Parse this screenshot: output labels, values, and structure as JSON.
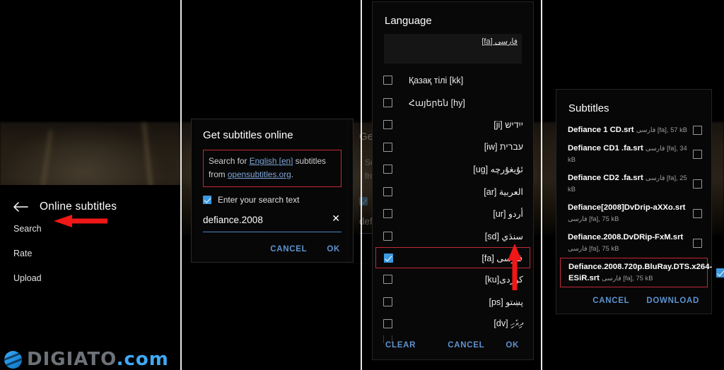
{
  "panel1": {
    "back_icon": "arrow-left-icon",
    "title": "Online subtitles",
    "items": [
      {
        "label": "Search"
      },
      {
        "label": "Rate"
      },
      {
        "label": "Upload"
      }
    ]
  },
  "watermark": {
    "name": "DIGIATO",
    "tld": ".com",
    "logo_icon": "digiato-logo-icon"
  },
  "panel2": {
    "title": "Get subtitles online",
    "desc_pre": "Search for ",
    "desc_link1": "English [en]",
    "desc_mid": " subtitles from ",
    "desc_link2": "opensubtitles.org",
    "desc_post": ".",
    "checkbox_label": "Enter your search text",
    "checkbox_checked": true,
    "search_value": "defiance.2008",
    "clear_icon": "close-icon",
    "cancel_label": "CANCEL",
    "ok_label": "OK"
  },
  "panel3": {
    "title": "Language",
    "filter_value": "فارسی [fa]",
    "languages": [
      {
        "label": "Қазақ тілі [kk]",
        "checked": false,
        "dir": "ltr"
      },
      {
        "label": "Հայերեն [hy]",
        "checked": false,
        "dir": "ltr"
      },
      {
        "label": "ייִדיש [ji]",
        "checked": false,
        "dir": "rtl"
      },
      {
        "label": "עברית [iw]",
        "checked": false,
        "dir": "rtl"
      },
      {
        "label": "ئۇيغۇرچە [ug]",
        "checked": false,
        "dir": "rtl"
      },
      {
        "label": "العربية [ar]",
        "checked": false,
        "dir": "rtl"
      },
      {
        "label": "أردو [ur]",
        "checked": false,
        "dir": "rtl"
      },
      {
        "label": "سنڌي [sd]",
        "checked": false,
        "dir": "rtl"
      },
      {
        "label": "فارسی [fa]",
        "checked": true,
        "dir": "rtl"
      },
      {
        "label": "کوردی[ku]",
        "checked": false,
        "dir": "rtl"
      },
      {
        "label": "پښتو [ps]",
        "checked": false,
        "dir": "rtl"
      },
      {
        "label": "ދިވެހި [dv]",
        "checked": false,
        "dir": "rtl"
      }
    ],
    "clear_label": "CLEAR",
    "cancel_label": "CANCEL",
    "ok_label": "OK"
  },
  "panel4": {
    "title": "Subtitles",
    "items": [
      {
        "name": "Defiance 1 CD.srt",
        "meta": "فارسی [fa], 57 kB",
        "checked": false
      },
      {
        "name": "Defiance  CD1 .fa.srt",
        "meta": "فارسی [fa], 34 kB",
        "checked": false
      },
      {
        "name": "Defiance  CD2 .fa.srt",
        "meta": "فارسی [fa], 25 kB",
        "checked": false
      },
      {
        "name": "Defiance[2008]DvDrip-aXXo.srt",
        "meta": "فارسی [fa], 75 kB",
        "checked": false
      },
      {
        "name": "Defiance.2008.DvDRip-FxM.srt",
        "meta": "فارسی [fa], 75 kB",
        "checked": false
      },
      {
        "name": "Defiance.2008.720p.BluRay.DTS.x264-ESiR.srt",
        "meta": "فارسی [fa], 75 kB",
        "checked": true
      }
    ],
    "cancel_label": "CANCEL",
    "download_label": "DOWNLOAD"
  },
  "annotations": {
    "arrow_color": "#ef1717",
    "highlight_color": "#c02a3a",
    "accent_color": "#5d93cf"
  }
}
